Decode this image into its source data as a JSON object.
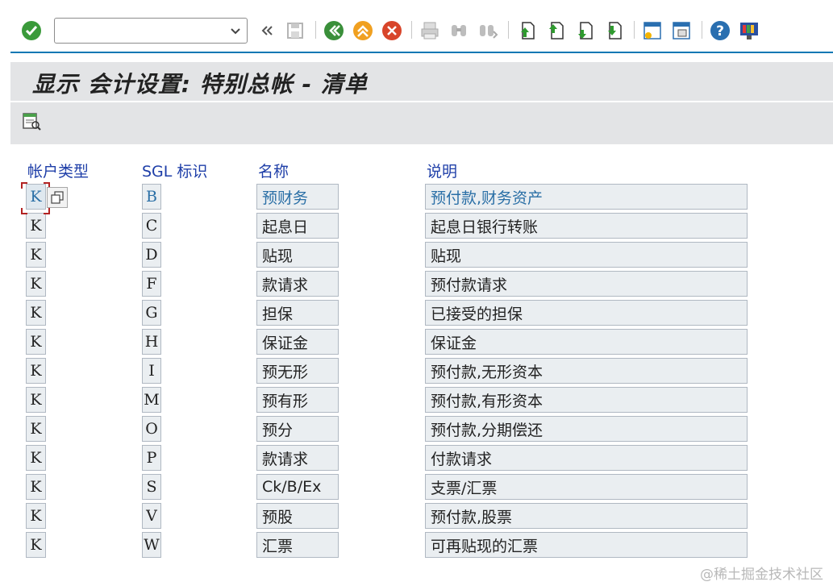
{
  "toolbar": {
    "command_value": "",
    "icons": [
      "enter-icon",
      "command-dropdown-icon",
      "collapse-icon",
      "save-icon",
      "back-icon",
      "exit-icon",
      "cancel-icon",
      "print-icon",
      "find-icon",
      "find-next-icon",
      "first-page-icon",
      "previous-page-icon",
      "next-page-icon",
      "last-page-icon",
      "new-session-icon",
      "shortcut-icon",
      "help-icon",
      "layout-icon"
    ]
  },
  "title": "显示 会计设置: 特别总帐 - 清单",
  "app_toolbar": {
    "icons": [
      "details-icon"
    ]
  },
  "table": {
    "headers": {
      "account_type": "帐户类型",
      "sgl": "SGL 标识",
      "name": "名称",
      "description": "说明"
    },
    "rows": [
      {
        "account_type": "K",
        "sgl": "B",
        "name": "预财务",
        "description": "预付款,财务资产"
      },
      {
        "account_type": "K",
        "sgl": "C",
        "name": "起息日",
        "description": "起息日银行转账"
      },
      {
        "account_type": "K",
        "sgl": "D",
        "name": "贴现",
        "description": "贴现"
      },
      {
        "account_type": "K",
        "sgl": "F",
        "name": "款请求",
        "description": "预付款请求"
      },
      {
        "account_type": "K",
        "sgl": "G",
        "name": "担保",
        "description": "已接受的担保"
      },
      {
        "account_type": "K",
        "sgl": "H",
        "name": "保证金",
        "description": "保证金"
      },
      {
        "account_type": "K",
        "sgl": "I",
        "name": "预无形",
        "description": "预付款,无形资本"
      },
      {
        "account_type": "K",
        "sgl": "M",
        "name": "预有形",
        "description": "预付款,有形资本"
      },
      {
        "account_type": "K",
        "sgl": "O",
        "name": "预分",
        "description": "预付款,分期偿还"
      },
      {
        "account_type": "K",
        "sgl": "P",
        "name": "款请求",
        "description": "付款请求"
      },
      {
        "account_type": "K",
        "sgl": "S",
        "name": "Ck/B/Ex",
        "description": "支票/汇票"
      },
      {
        "account_type": "K",
        "sgl": "V",
        "name": "预股",
        "description": "预付款,股票"
      },
      {
        "account_type": "K",
        "sgl": "W",
        "name": "汇票",
        "description": "可再贴现的汇票"
      }
    ]
  },
  "watermark": "@稀土掘金技术社区",
  "colors": {
    "header_text": "#1e3ea8",
    "accent": "#0a78b4",
    "cell_bg": "#eaeef1",
    "focus": "#b22222"
  }
}
